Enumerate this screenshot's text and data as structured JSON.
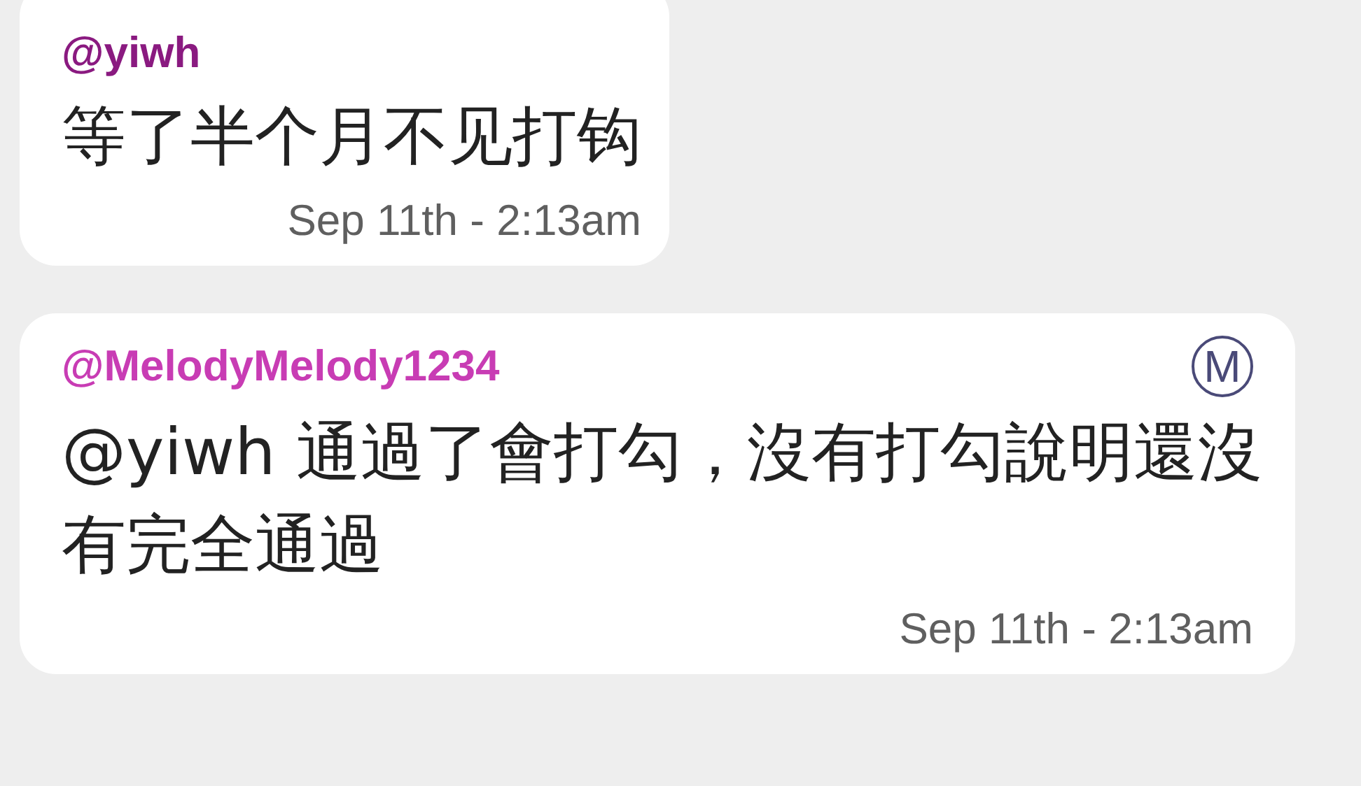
{
  "messages": [
    {
      "author": "@yiwh",
      "color": "#8a1a80",
      "text": "等了半个月不见打钩",
      "time": "Sep 11th - 2:13am"
    },
    {
      "author": "@MelodyMelody1234",
      "color": "#c83cb4",
      "badge": "M",
      "text": "@yiwh 通過了會打勾，沒有打勾說明還沒有完全通過",
      "time": "Sep 11th - 2:13am"
    }
  ]
}
